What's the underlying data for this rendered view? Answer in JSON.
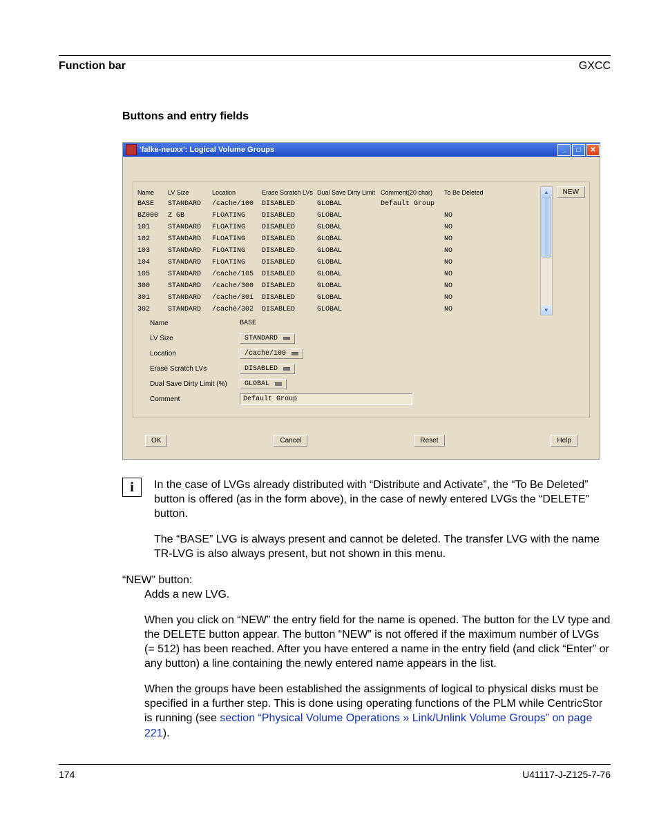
{
  "header": {
    "left": "Function bar",
    "right": "GXCC"
  },
  "section_heading": "Buttons and entry fields",
  "window": {
    "title": "'falke-neuxx':  Logical Volume Groups",
    "table_headers": [
      "Name",
      "LV Size",
      "Location",
      "Erase Scratch LVs",
      "Dual Save Dirty Limit",
      "Comment(20 char)",
      "To Be Deleted"
    ],
    "rows": [
      {
        "name": "BASE",
        "lvsize": "STANDARD",
        "loc": "/cache/100",
        "erase": "DISABLED",
        "dual": "GLOBAL",
        "comment": "Default Group",
        "del": ""
      },
      {
        "name": "BZ000",
        "lvsize": "Z GB",
        "loc": "FLOATING",
        "erase": "DISABLED",
        "dual": "GLOBAL",
        "comment": "",
        "del": "NO"
      },
      {
        "name": "101",
        "lvsize": "STANDARD",
        "loc": "FLOATING",
        "erase": "DISABLED",
        "dual": "GLOBAL",
        "comment": "",
        "del": "NO"
      },
      {
        "name": "102",
        "lvsize": "STANDARD",
        "loc": "FLOATING",
        "erase": "DISABLED",
        "dual": "GLOBAL",
        "comment": "",
        "del": "NO"
      },
      {
        "name": "103",
        "lvsize": "STANDARD",
        "loc": "FLOATING",
        "erase": "DISABLED",
        "dual": "GLOBAL",
        "comment": "",
        "del": "NO"
      },
      {
        "name": "104",
        "lvsize": "STANDARD",
        "loc": "FLOATING",
        "erase": "DISABLED",
        "dual": "GLOBAL",
        "comment": "",
        "del": "NO"
      },
      {
        "name": "105",
        "lvsize": "STANDARD",
        "loc": "/cache/105",
        "erase": "DISABLED",
        "dual": "GLOBAL",
        "comment": "",
        "del": "NO"
      },
      {
        "name": "300",
        "lvsize": "STANDARD",
        "loc": "/cache/300",
        "erase": "DISABLED",
        "dual": "GLOBAL",
        "comment": "",
        "del": "NO"
      },
      {
        "name": "301",
        "lvsize": "STANDARD",
        "loc": "/cache/301",
        "erase": "DISABLED",
        "dual": "GLOBAL",
        "comment": "",
        "del": "NO"
      },
      {
        "name": "302",
        "lvsize": "STANDARD",
        "loc": "/cache/302",
        "erase": "DISABLED",
        "dual": "GLOBAL",
        "comment": "",
        "del": "NO"
      }
    ],
    "new_button": "NEW",
    "fields": {
      "name": {
        "label": "Name",
        "value": "BASE"
      },
      "lvsize": {
        "label": "LV Size",
        "value": "STANDARD"
      },
      "loc": {
        "label": "Location",
        "value": "/cache/100"
      },
      "erase": {
        "label": "Erase Scratch LVs",
        "value": "DISABLED"
      },
      "dual": {
        "label": "Dual Save Dirty Limit (%)",
        "value": "GLOBAL"
      },
      "comment": {
        "label": "Comment",
        "value": "Default Group"
      }
    },
    "buttons": {
      "ok": "OK",
      "cancel": "Cancel",
      "reset": "Reset",
      "help": "Help"
    }
  },
  "info_para1": "In the case of LVGs already distributed with “Distribute and Activate”, the “To Be Deleted” button is offered (as in the form above), in the case of newly entered LVGs the “DELETE” button.",
  "info_para2": "The “BASE” LVG is always present and cannot be deleted. The transfer LVG with the name TR-LVG is also always present, but not shown in this menu.",
  "new_label": "“NEW” button:",
  "new_line1": "Adds a new LVG.",
  "new_para2": "When you click on “NEW” the entry field for the name is opened. The button for the LV type and the DELETE button appear. The button “NEW” is not offered if the maximum number of LVGs (= 512) has been reached. After you have entered a name in the entry field (and click “Enter” or any button) a line containing the newly entered name appears in the list.",
  "new_para3a": "When the groups have been established the assignments of logical to physical disks must be specified in a further step. This is done using operating functions of the PLM while CentricStor is running (see ",
  "new_para3_link": "section “Physical Volume Operations » Link/Unlink Volume Groups” on page 221",
  "new_para3b": ").",
  "footer": {
    "page": "174",
    "doc": "U41117-J-Z125-7-76"
  }
}
